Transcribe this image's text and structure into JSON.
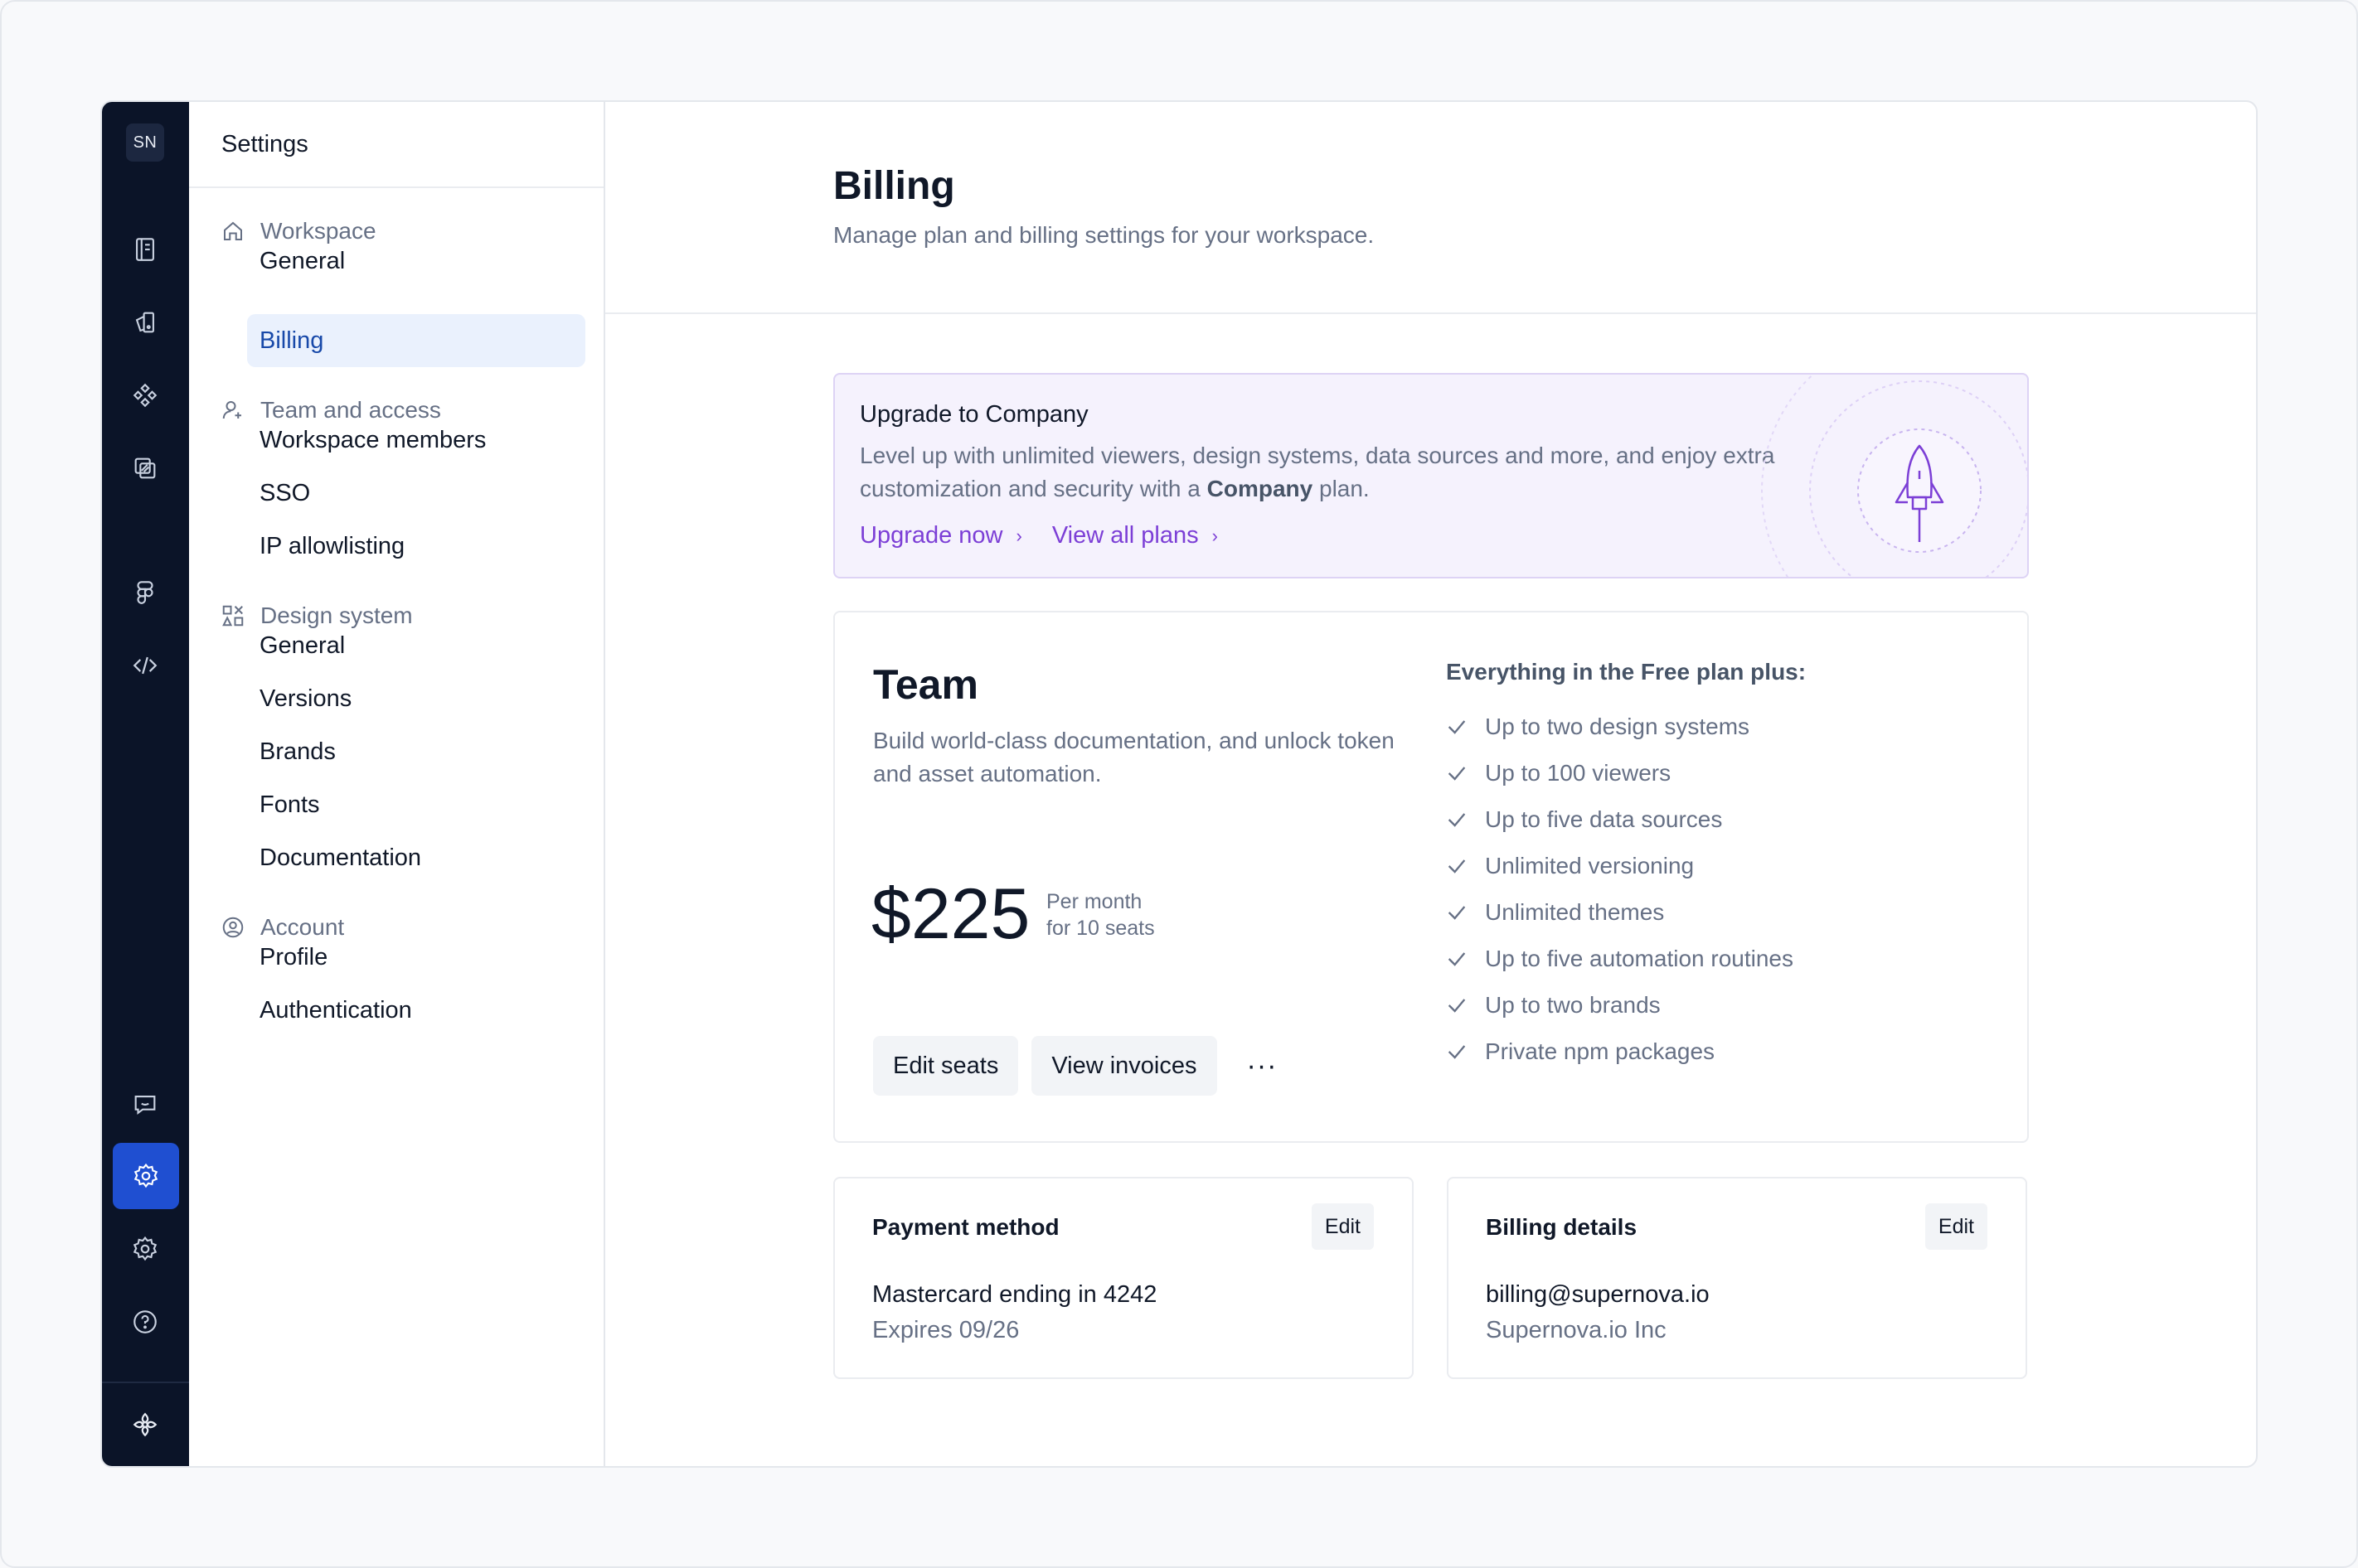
{
  "rail": {
    "workspace_initials": "SN",
    "icons": [
      "docs-icon",
      "assets-icon",
      "components-icon",
      "tokens-icon",
      "figma-icon",
      "code-icon",
      "feedback-icon",
      "settings-icon",
      "preferences-icon",
      "help-icon",
      "logo-icon"
    ],
    "active_icon": "settings-icon",
    "accent": "#1f4fd1",
    "background": "#0b1428"
  },
  "nav": {
    "title": "Settings",
    "groups": [
      {
        "label": "Workspace",
        "icon": "home-icon",
        "items": [
          "General",
          "Billing"
        ]
      },
      {
        "label": "Team and access",
        "icon": "user-plus-icon",
        "items": [
          "Workspace members",
          "SSO",
          "IP allowlisting"
        ]
      },
      {
        "label": "Design system",
        "icon": "shapes-icon",
        "items": [
          "General",
          "Versions",
          "Brands",
          "Fonts",
          "Documentation"
        ]
      },
      {
        "label": "Account",
        "icon": "user-circle-icon",
        "items": [
          "Profile",
          "Authentication"
        ]
      }
    ],
    "active_item": "Billing"
  },
  "header": {
    "title": "Billing",
    "subtitle": "Manage plan and billing settings for your workspace."
  },
  "upgrade": {
    "title": "Upgrade to Company",
    "text_before": "Level up with unlimited viewers, design systems, data sources and more, and enjoy extra customization and security with a ",
    "text_bold": "Company",
    "text_after": " plan.",
    "link_upgrade": "Upgrade now",
    "link_plans": "View all plans",
    "icon": "rocket-icon",
    "accent": "#7c3fd6"
  },
  "plan": {
    "name": "Team",
    "description": "Build world-class documentation, and unlock token and asset automation.",
    "price": "$225",
    "per_line1": "Per month",
    "per_line2": "for 10 seats",
    "edit_seats": "Edit seats",
    "view_invoices": "View invoices",
    "more": "···",
    "features_title": "Everything in the Free plan plus:",
    "features": [
      "Up to two design systems",
      "Up to 100 viewers",
      "Up to five data sources",
      "Unlimited versioning",
      "Unlimited themes",
      "Up to five automation routines",
      "Up to two brands",
      "Private npm packages"
    ]
  },
  "payment": {
    "title": "Payment method",
    "edit": "Edit",
    "line1": "Mastercard ending in 4242",
    "line2": "Expires 09/26"
  },
  "billing_details": {
    "title": "Billing details",
    "edit": "Edit",
    "line1": "billing@supernova.io",
    "line2": "Supernova.io Inc"
  }
}
